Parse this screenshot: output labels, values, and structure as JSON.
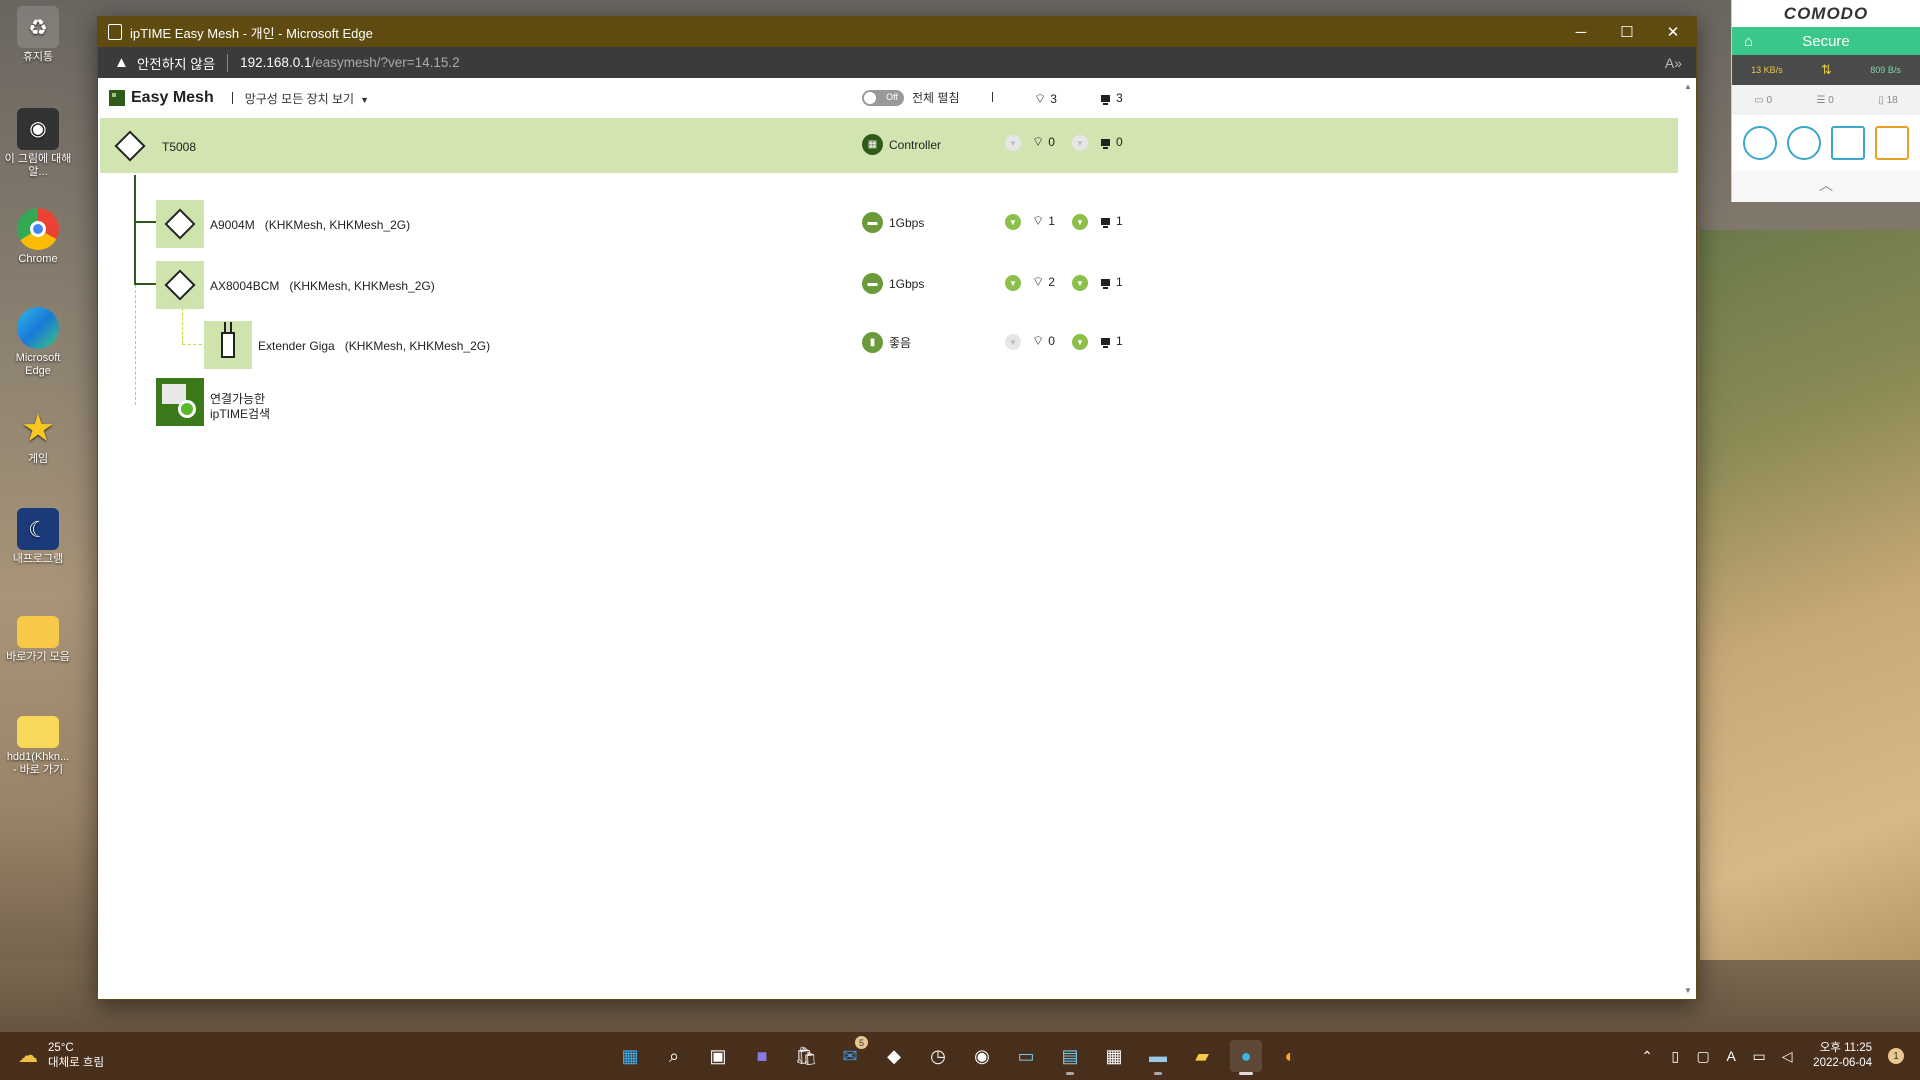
{
  "desktop": {
    "icons": [
      {
        "label": "휴지통",
        "icon": "recycle-bin-icon"
      },
      {
        "label": "이 그림에 대해 알...",
        "icon": "camera-icon"
      },
      {
        "label": "Chrome",
        "icon": "chrome-icon"
      },
      {
        "label": "Microsoft Edge",
        "icon": "edge-icon"
      },
      {
        "label": "게임",
        "icon": "star-icon"
      },
      {
        "label": "내프로그램",
        "icon": "moon-app-icon"
      },
      {
        "label": "바로가기 모음",
        "icon": "folder-icon"
      },
      {
        "label": "hdd1(Khkn... - 바로 가기",
        "icon": "folder-shortcut-icon"
      }
    ]
  },
  "window": {
    "title": "ipTIME Easy Mesh - 개인 - Microsoft Edge",
    "controls": {
      "minimize": "─",
      "maximize": "☐",
      "close": "✕"
    }
  },
  "address": {
    "security": "안전하지 않음",
    "host": "192.168.0.1",
    "path": "/easymesh/?ver=14.15.2"
  },
  "easymesh": {
    "title": "Easy Mesh",
    "view_menu": "망구성 모든 장치 보기",
    "toggle_state": "Off",
    "toggle_label": "전체 펼침",
    "total_wifi": "3",
    "total_wired": "3",
    "devices": [
      {
        "name": "T5008",
        "ssid": "",
        "connection": "Controller",
        "wifi": "0",
        "wired": "0",
        "wifi_arrow": false,
        "wired_arrow": false
      },
      {
        "name": "A9004M",
        "ssid": "(KHKMesh, KHKMesh_2G)",
        "connection": "1Gbps",
        "wifi": "1",
        "wired": "1",
        "wifi_arrow": true,
        "wired_arrow": true
      },
      {
        "name": "AX8004BCM",
        "ssid": "(KHKMesh, KHKMesh_2G)",
        "connection": "1Gbps",
        "wifi": "2",
        "wired": "1",
        "wifi_arrow": true,
        "wired_arrow": true
      },
      {
        "name": "Extender Giga",
        "ssid": "(KHKMesh, KHKMesh_2G)",
        "connection": "좋음",
        "wifi": "0",
        "wired": "1",
        "wifi_arrow": false,
        "wired_arrow": true
      }
    ],
    "search_label_1": "연결가능한",
    "search_label_2": "ipTIME검색"
  },
  "comodo": {
    "brand": "COMODO",
    "status": "Secure",
    "download_speed": "13 KB/s",
    "upload_speed": "809 B/s",
    "counter_1": "0",
    "counter_2": "0",
    "counter_3": "18"
  },
  "taskbar": {
    "temperature": "25°C",
    "weather": "대체로 흐림",
    "badge_count": "5",
    "time": "오후 11:25",
    "date": "2022-06-04",
    "notifications": "1"
  },
  "colors": {
    "accent_green": "#6a9a3a",
    "highlight_row": "#d2e4b0",
    "titlebar": "#5f4a10",
    "comodo_secure": "#3ac88a"
  }
}
